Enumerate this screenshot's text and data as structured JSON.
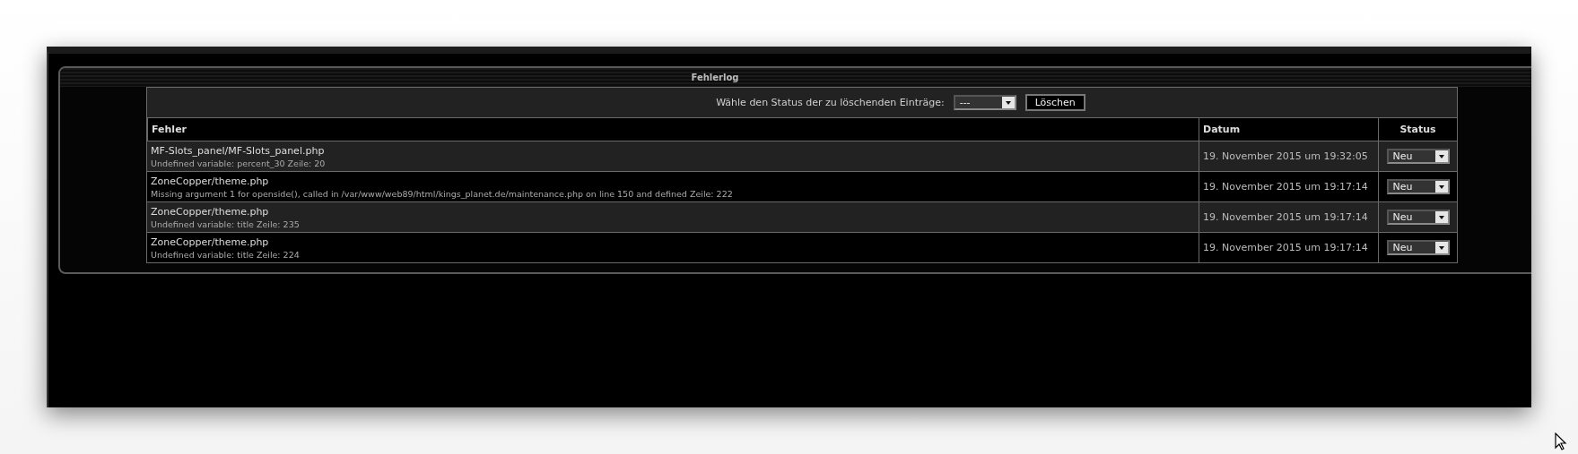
{
  "panel": {
    "title": "Fehlerlog"
  },
  "delete_bar": {
    "label": "Wähle den Status der zu löschenden Einträge:",
    "status_select": {
      "value": "---"
    },
    "delete_button": "Löschen"
  },
  "table": {
    "columns": [
      "Fehler",
      "Datum",
      "Status"
    ],
    "rows": [
      {
        "file": "MF-Slots_panel/MF-Slots_panel.php",
        "message": "Undefined variable: percent_30 Zeile: 20",
        "date": "19. November 2015 um 19:32:05",
        "status": "Neu"
      },
      {
        "file": "ZoneCopper/theme.php",
        "message": "Missing argument 1 for openside(), called in /var/www/web89/html/kings_planet.de/maintenance.php on line 150 and defined Zeile: 222",
        "date": "19. November 2015 um 19:17:14",
        "status": "Neu"
      },
      {
        "file": "ZoneCopper/theme.php",
        "message": "Undefined variable: title Zeile: 235",
        "date": "19. November 2015 um 19:17:14",
        "status": "Neu"
      },
      {
        "file": "ZoneCopper/theme.php",
        "message": "Undefined variable: title Zeile: 224",
        "date": "19. November 2015 um 19:17:14",
        "status": "Neu"
      }
    ]
  }
}
